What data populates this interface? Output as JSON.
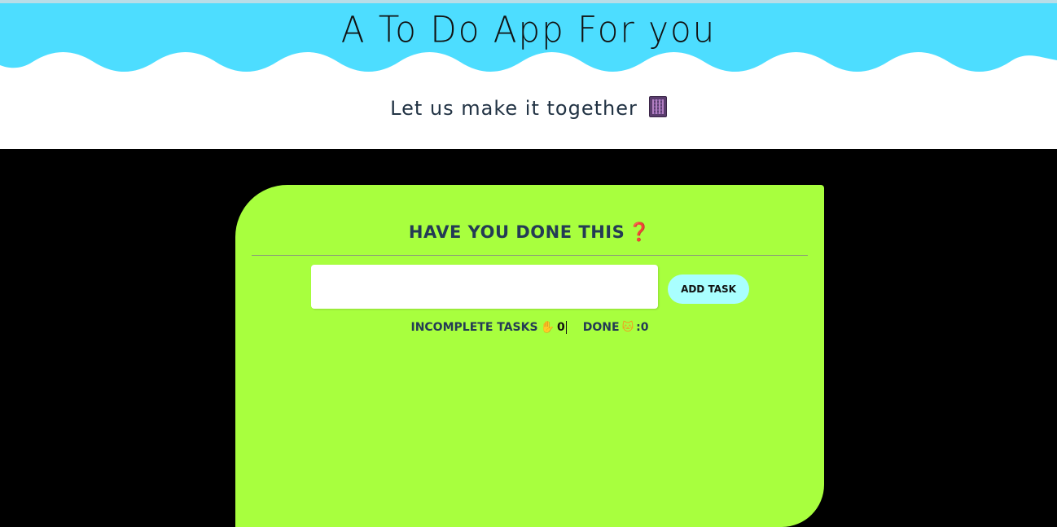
{
  "header": {
    "title": "A To Do App For you",
    "subtitle": "Let us make it together",
    "subtitle_icon": "notebook-icon",
    "wave_color": "#4dddff",
    "background": "#ffffff"
  },
  "card": {
    "background": "#a8ff3e",
    "title": "Have you done this",
    "title_icon": "question-mark-icon",
    "input": {
      "value": "",
      "placeholder": ""
    },
    "add_button_label": "Add Task",
    "stats": {
      "incomplete_label": "Incomplete Tasks",
      "incomplete_icon": "raised-hand-icon",
      "incomplete_count": "0",
      "done_label": "Done",
      "done_icon": "cat-face-icon",
      "done_count": ":0"
    }
  },
  "colors": {
    "page_background": "#000000",
    "button_background": "#a9ffff",
    "title_text": "#243b55"
  }
}
